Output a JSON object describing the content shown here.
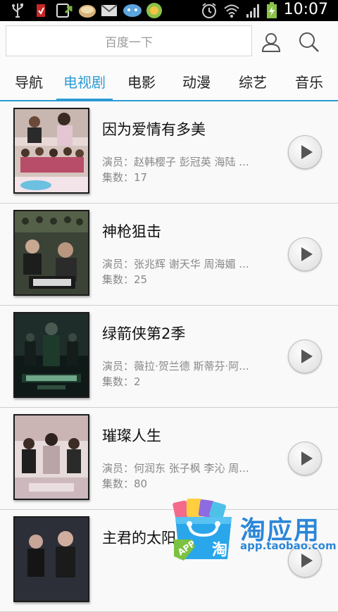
{
  "status_bar": {
    "time": "10:07",
    "icons": [
      "usb-icon",
      "notification-icon",
      "upload-icon",
      "app-icon",
      "mail-icon",
      "chat-icon",
      "app-icon-2",
      "alarm-icon",
      "wifi-icon",
      "signal-icon",
      "battery-charging-icon"
    ]
  },
  "search": {
    "placeholder": "百度一下"
  },
  "header_icons": [
    "user-icon",
    "search-icon"
  ],
  "tabs": [
    {
      "label": "导航",
      "active": false
    },
    {
      "label": "电视剧",
      "active": true
    },
    {
      "label": "电影",
      "active": false
    },
    {
      "label": "动漫",
      "active": false
    },
    {
      "label": "综艺",
      "active": false
    },
    {
      "label": "音乐",
      "active": false
    }
  ],
  "shows": [
    {
      "title": "因为爱情有多美",
      "actors": "演员：赵韩樱子 彭冠英 海陆 ...",
      "episodes": "集数：17"
    },
    {
      "title": "神枪狙击",
      "actors": "演员：张兆辉 谢天华 周海媚 ...",
      "episodes": "集数：25"
    },
    {
      "title": "绿箭侠第2季",
      "actors": "演员：薇拉·贺兰德 斯蒂芬·阿...",
      "episodes": "集数：2"
    },
    {
      "title": "璀璨人生",
      "actors": "演员：何润东 张子枫 李沁 周...",
      "episodes": "集数：80"
    },
    {
      "title": "主君的太阳",
      "actors": "",
      "episodes": ""
    }
  ],
  "watermark": {
    "name": "淘应用",
    "url": "app.taobao.com",
    "badge": "APP",
    "bag_char": "淘"
  },
  "colors": {
    "accent": "#2c9bd4",
    "status_bar": "#000000",
    "watermark": "#2b86d8"
  }
}
